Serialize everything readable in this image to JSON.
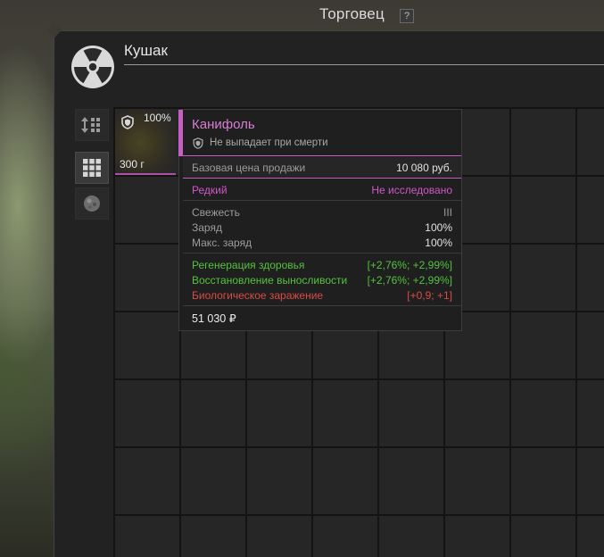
{
  "window": {
    "title": "Торговец",
    "help_label": "?"
  },
  "section": {
    "title": "Кушак",
    "icon": "radiation-icon"
  },
  "side_tabs": [
    {
      "name": "sort-icon",
      "active": false
    },
    {
      "name": "grid-view-icon",
      "active": true
    },
    {
      "name": "artifact-icon",
      "active": false
    }
  ],
  "item": {
    "charge": "100%",
    "weight": "300 г",
    "icon": "shield-icon"
  },
  "tooltip": {
    "title": "Канифоль",
    "subtitle": "Не выпадает при смерти",
    "base_price_label": "Базовая цена продажи",
    "base_price_value": "10 080 руб.",
    "rarity_label": "Редкий",
    "research_status": "Не исследовано",
    "freshness_label": "Свежесть",
    "freshness_value": "III",
    "charge_label": "Заряд",
    "charge_value": "100%",
    "max_charge_label": "Макс. заряд",
    "max_charge_value": "100%",
    "stats": [
      {
        "label": "Регенерация здоровья",
        "value": "[+2,76%; +2,99%]",
        "kind": "positive"
      },
      {
        "label": "Восстановление выносливости",
        "value": "[+2,76%; +2,99%]",
        "kind": "positive"
      },
      {
        "label": "Биологическое заражение",
        "value": "[+0,9; +1]",
        "kind": "negative"
      }
    ],
    "total_price": "51 030 ₽"
  },
  "colors": {
    "rarity_accent": "#c65fc3",
    "positive": "#55c23e",
    "negative": "#d94b44"
  }
}
